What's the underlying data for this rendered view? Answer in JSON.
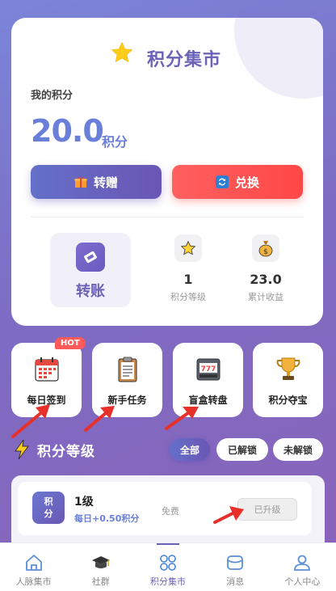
{
  "header": {
    "title": "积分集市",
    "star_icon": "star-icon"
  },
  "points": {
    "label": "我的积分",
    "value": "20.0",
    "unit": "积分"
  },
  "actions": [
    {
      "label": "转赠",
      "icon": "gift-icon",
      "color": "#6470c9"
    },
    {
      "label": "兑换",
      "icon": "exchange-icon",
      "color": "#ff5050"
    }
  ],
  "transfer": {
    "label": "转账",
    "icon": "transfer-icon"
  },
  "stats": [
    {
      "value": "1",
      "label": "积分等级",
      "icon": "star-icon"
    },
    {
      "value": "23.0",
      "label": "累计收益",
      "icon": "money-bag-icon"
    }
  ],
  "features": [
    {
      "label": "每日签到",
      "icon": "calendar-icon",
      "badge": "HOT"
    },
    {
      "label": "新手任务",
      "icon": "clipboard-icon"
    },
    {
      "label": "盲盒转盘",
      "icon": "slot-machine-icon"
    },
    {
      "label": "积分夺宝",
      "icon": "trophy-icon"
    }
  ],
  "levels_section": {
    "title": "积分等级",
    "filters": [
      "全部",
      "已解锁",
      "未解锁"
    ],
    "active_filter": "全部",
    "items": [
      {
        "badge_top": "积",
        "badge_bottom": "分",
        "name": "1级",
        "daily": "每日+0.50积分",
        "price": "免费",
        "button": "已升级"
      }
    ]
  },
  "tabbar": {
    "items": [
      {
        "label": "人脉集市",
        "icon": "home-icon"
      },
      {
        "label": "社群",
        "icon": "graduation-cap-icon"
      },
      {
        "label": "积分集市",
        "icon": "grid-icon"
      },
      {
        "label": "消息",
        "icon": "message-icon"
      },
      {
        "label": "个人中心",
        "icon": "user-icon"
      }
    ],
    "active_index": 2
  },
  "colors": {
    "accent": "#6a63b8",
    "primary_blue": "#6a7fd8",
    "danger": "#ff5050",
    "hot": "#ff5a5a"
  }
}
